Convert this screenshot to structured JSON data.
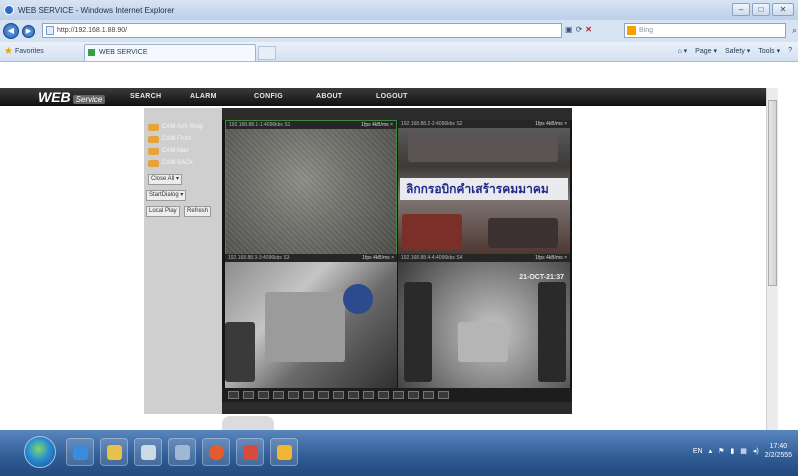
{
  "window": {
    "title": "WEB SERVICE - Windows Internet Explorer",
    "minimize": "–",
    "maximize": "□",
    "close": "✕"
  },
  "address": {
    "url": "http://192.168.1.88.90/",
    "search_placeholder": "Bing",
    "back": "◀",
    "forward": "▶"
  },
  "favorites": {
    "label": "Favorites",
    "tab_title": "WEB SERVICE",
    "commands": [
      "Page ▾",
      "Safety ▾",
      "Tools ▾",
      "?"
    ]
  },
  "app": {
    "logo": "WEB",
    "logo_sub": "Service",
    "menu": [
      "SEARCH",
      "ALARM",
      "CONFIG",
      "ABOUT",
      "LOGOUT"
    ]
  },
  "controls": {
    "cameras": [
      "CAM Arm Shop",
      "CAM Front",
      "CAM Man",
      "CAM BACK"
    ],
    "close_all": "Close All",
    "start_dialog": "StartDialog",
    "local_play": "Local Play",
    "refresh": "Refresh"
  },
  "cells": [
    {
      "header": "192.168.88.1-1:4096kbs S1",
      "rate": "1fps 4kB/ms ×"
    },
    {
      "header": "192.168.88.2-2:4096kbs S2",
      "rate": "1fps 4kB/ms ×"
    },
    {
      "header": "192.168.88.3-3:4096kbs S3",
      "rate": "1fps 4kB/ms ×"
    },
    {
      "header": "192.168.88.4-4:4096kbs S4",
      "rate": "1fps 4kB/ms ×"
    }
  ],
  "overlay": {
    "sign_text": "ลิกกรอบิกคำเสร้ารคมมาคม",
    "timestamp": "21-OCT-21:37"
  },
  "taskbar": {
    "lang": "EN",
    "time": "17:40",
    "date": "2/2/2555"
  }
}
